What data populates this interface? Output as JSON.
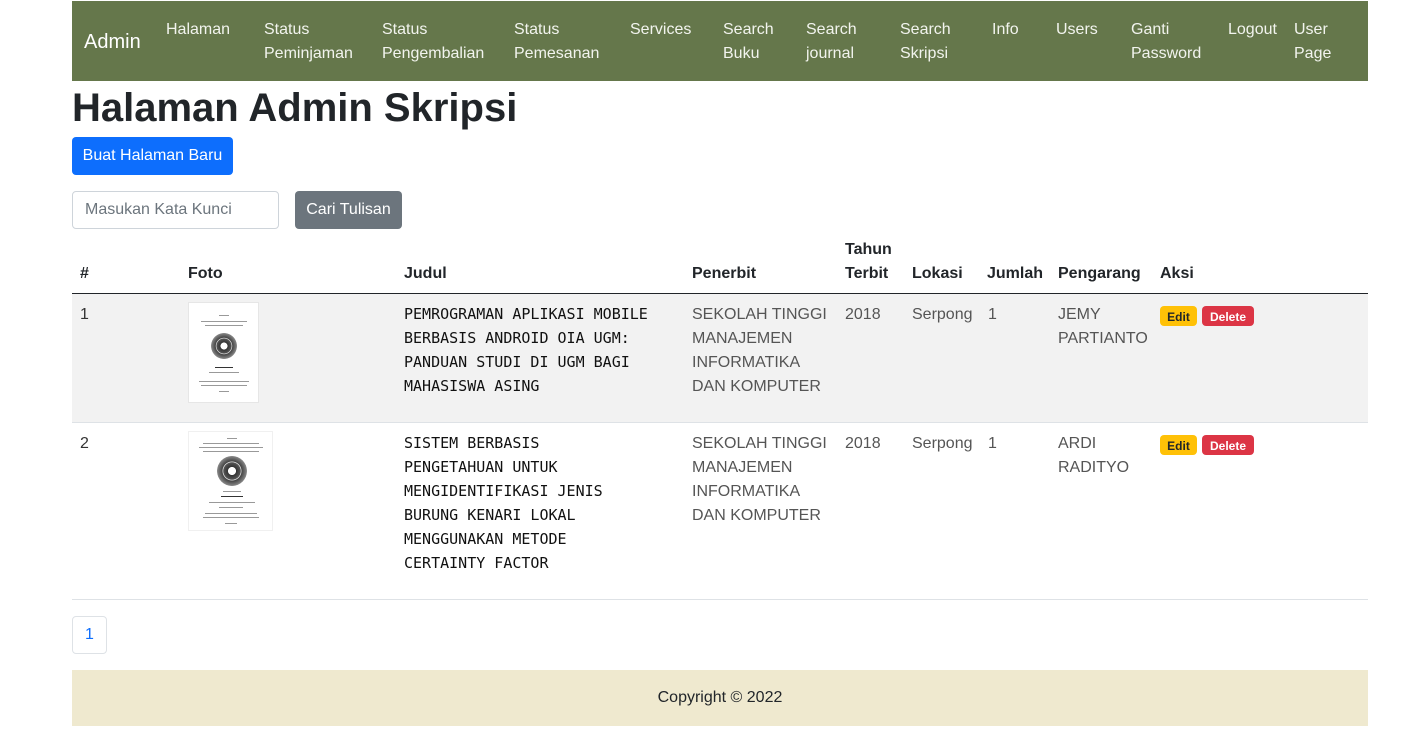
{
  "navbar": {
    "brand": "Admin",
    "items": [
      {
        "label": "Halaman"
      },
      {
        "label": "Status\nPeminjaman"
      },
      {
        "label": "Status\nPengembalian"
      },
      {
        "label": "Status\nPemesanan"
      },
      {
        "label": "Services"
      },
      {
        "label": "Search\nBuku"
      },
      {
        "label": "Search\njournal"
      },
      {
        "label": "Search\nSkripsi"
      },
      {
        "label": "Info"
      },
      {
        "label": "Users"
      },
      {
        "label": "Ganti\nPassword"
      },
      {
        "label": "Logout"
      },
      {
        "label": "User\nPage"
      }
    ]
  },
  "page": {
    "title": "Halaman Admin Skripsi",
    "new_button": "Buat Halaman Baru"
  },
  "search": {
    "placeholder": "Masukan Kata Kunci",
    "value": "",
    "button": "Cari Tulisan"
  },
  "table": {
    "headers": [
      "#",
      "Foto",
      "Judul",
      "Penerbit",
      "Tahun\nTerbit",
      "Lokasi",
      "Jumlah",
      "Pengarang",
      "Aksi"
    ],
    "rows": [
      {
        "no": "1",
        "judul": "PEMROGRAMAN APLIKASI MOBILE BERBASIS ANDROID OIA UGM: PANDUAN STUDI DI UGM BAGI MAHASISWA ASING",
        "penerbit": "SEKOLAH TINGGI MANAJEMEN INFORMATIKA DAN KOMPUTER",
        "tahun": "2018",
        "lokasi": "Serpong",
        "jumlah": "1",
        "pengarang": "JEMY PARTIANTO",
        "edit": "Edit",
        "delete": "Delete"
      },
      {
        "no": "2",
        "judul": "SISTEM BERBASIS PENGETAHUAN UNTUK MENGIDENTIFIKASI JENIS BURUNG KENARI LOKAL MENGGUNAKAN METODE CERTAINTY FACTOR",
        "penerbit": "SEKOLAH TINGGI MANAJEMEN INFORMATIKA DAN KOMPUTER",
        "tahun": "2018",
        "lokasi": "Serpong",
        "jumlah": "1",
        "pengarang": "ARDI RADITYO",
        "edit": "Edit",
        "delete": "Delete"
      }
    ]
  },
  "pagination": {
    "current": "1"
  },
  "footer": {
    "text": "Copyright © 2022"
  },
  "colors": {
    "navbar": "#65774b",
    "primary": "#0d6efd",
    "secondary": "#6c757d",
    "warning": "#ffc107",
    "danger": "#dc3545",
    "footer": "#efe9cf"
  }
}
